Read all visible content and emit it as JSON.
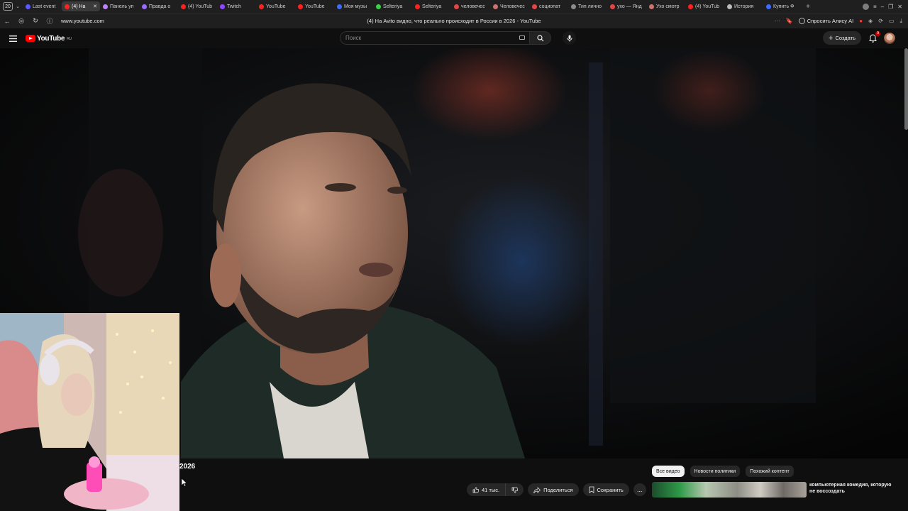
{
  "browser": {
    "tab_count": "20",
    "tabs": [
      {
        "label": "Last event",
        "color": "#5a5aff"
      },
      {
        "label": "(4) На",
        "color": "#ff2020",
        "active": true
      },
      {
        "label": "Панель уп",
        "color": "#c080ff"
      },
      {
        "label": "Правда о",
        "color": "#9b6bff"
      },
      {
        "label": "(4) YouTub",
        "color": "#ff2020"
      },
      {
        "label": "Twitch",
        "color": "#9146ff"
      },
      {
        "label": "YouTube",
        "color": "#ff2020"
      },
      {
        "label": "YouTube",
        "color": "#ff2020"
      },
      {
        "label": "Моя музы",
        "color": "#3d6bff"
      },
      {
        "label": "Selteriya",
        "color": "#3ecf4a"
      },
      {
        "label": "Selteriya",
        "color": "#ff2020"
      },
      {
        "label": "человечес",
        "color": "#e04848"
      },
      {
        "label": "Человечес",
        "color": "#d07070"
      },
      {
        "label": "социопат",
        "color": "#e04848"
      },
      {
        "label": "Тип лично",
        "color": "#8c8c8c"
      },
      {
        "label": "ухо — Янд",
        "color": "#e04848"
      },
      {
        "label": "Ухо смотр",
        "color": "#d07070"
      },
      {
        "label": "(4) YouTub",
        "color": "#ff2020"
      },
      {
        "label": "История",
        "color": "#bbbbbb"
      },
      {
        "label": "Купить Ф",
        "color": "#3d6bff"
      }
    ],
    "url": "www.youtube.com",
    "page_title": "(4) На Avito видно, что реально происходит в России в 2026 - YouTube",
    "ask_alice": "Спросить Алису AI"
  },
  "youtube": {
    "logo_text": "YouTube",
    "region": "RU",
    "search_placeholder": "Поиск",
    "create_label": "Создать",
    "notifications_count": "9",
    "video_title_fragment": "2026",
    "actions": {
      "likes": "41 тыс.",
      "share": "Поделиться",
      "save": "Сохранить",
      "more": "..."
    },
    "chips": [
      "Все видео",
      "Новости политики",
      "Похожий контент"
    ],
    "recommendation_title": "компьютерная комедия, которую не воссоздать"
  }
}
